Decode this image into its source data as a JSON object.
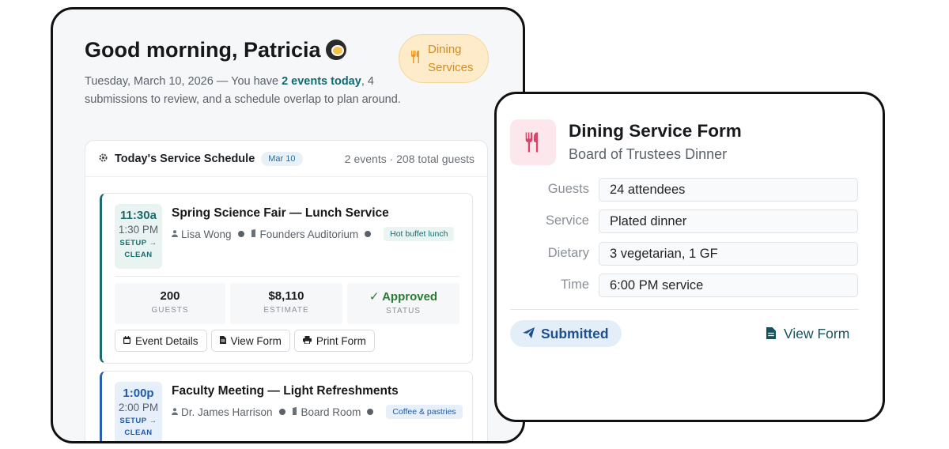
{
  "greeting": {
    "title": "Good morning, Patricia",
    "emoji_icon": "frying-pan-icon"
  },
  "dining_badge": {
    "line1": "Dining",
    "line2": "Services",
    "icon": "fork-knife-icon"
  },
  "summary": {
    "prefix": "Tuesday, March 10, 2026 — You have ",
    "highlight": "2 events today",
    "suffix": ", 4 submissions to review, and a schedule overlap to plan around."
  },
  "schedule": {
    "title": "Today's Service Schedule",
    "date_badge": "Mar 10",
    "meta": "2 events · 208 total guests",
    "events": [
      {
        "time_start": "11:30a",
        "time_end": "1:30 PM",
        "setup_line1": "SETUP →",
        "setup_line2": "CLEAN",
        "name": "Spring Science Fair — Lunch Service",
        "host": "Lisa Wong",
        "location": "Founders Auditorium",
        "tag": "Hot buffet lunch",
        "stats": [
          {
            "value": "200",
            "label": "GUESTS"
          },
          {
            "value": "$8,110",
            "label": "ESTIMATE"
          },
          {
            "value": "✓ Approved",
            "label": "STATUS"
          }
        ],
        "buttons": [
          "Event Details",
          "View Form",
          "Print Form"
        ]
      },
      {
        "time_start": "1:00p",
        "time_end": "2:00 PM",
        "setup_line1": "SETUP →",
        "setup_line2": "CLEAN",
        "name": "Faculty Meeting — Light Refreshments",
        "host": "Dr. James Harrison",
        "location": "Board Room",
        "tag": "Coffee & pastries"
      }
    ]
  },
  "form_card": {
    "title": "Dining Service Form",
    "subtitle": "Board of Trustees Dinner",
    "fields": [
      {
        "label": "Guests",
        "value": "24 attendees"
      },
      {
        "label": "Service",
        "value": "Plated dinner"
      },
      {
        "label": "Dietary",
        "value": "3 vegetarian, 1 GF"
      },
      {
        "label": "Time",
        "value": "6:00 PM service"
      }
    ],
    "status": "Submitted",
    "view_link": "View Form",
    "accent": "#d94468"
  }
}
